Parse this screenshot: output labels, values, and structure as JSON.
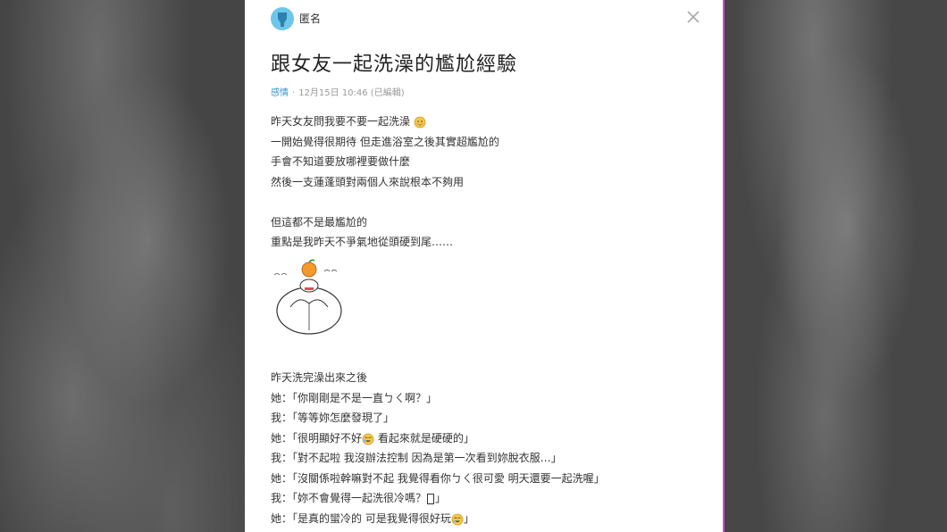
{
  "post": {
    "author": "匿名",
    "title": "跟女友一起洗澡的尷尬經驗",
    "forum": "感情",
    "timestamp": "12月15日 10:46 (已編輯)",
    "lines": [
      "昨天女友問我要不要一起洗澡",
      "一開始覺得很期待 但走進浴室之後其實超尷尬的",
      "手會不知道要放哪裡要做什麼",
      "然後一支蓮蓬頭對兩個人來說根本不夠用",
      "但這都不是最尷尬的",
      "重點是我昨天不爭氣地從頭硬到尾……",
      "昨天洗完澡出來之後",
      "她：「你剛剛是不是一直ㄅㄑ啊？」",
      "我：「等等妳怎麼發現了」",
      "她：「很明顯好不好",
      " 看起來就是硬硬的」",
      "我：「對不起啦 我沒辦法控制 因為是第一次看到妳脫衣服…」",
      "她：「沒關係啦幹嘛對不起 我覺得看你ㄅㄑ很可愛 明天還要一起洗喔」",
      "我：「妳不會覺得一起洗很冷嗎？",
      "」",
      "她：「是真的蠻冷的 可是我覺得很好玩",
      "」"
    ]
  },
  "colors": {
    "accent": "#3397cf",
    "border": "#c04fd0"
  },
  "icons": {
    "close": "close-icon",
    "avatar": "anonymous-avatar-icon",
    "emoji": "emoji-icon"
  }
}
